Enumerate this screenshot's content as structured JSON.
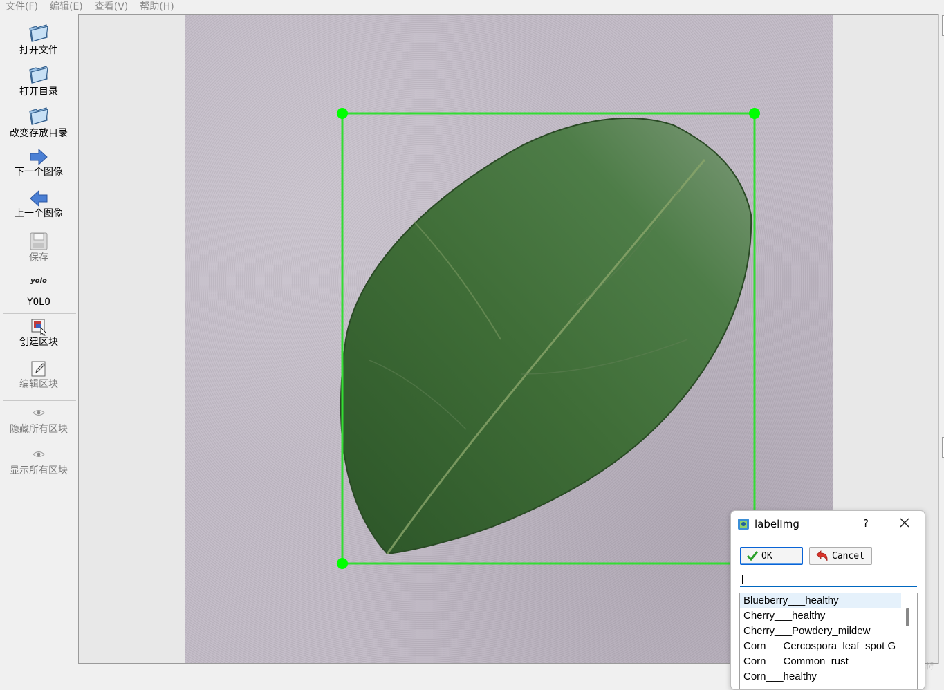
{
  "menubar": {
    "items": [
      "文件(F)",
      "编辑(E)",
      "查看(V)",
      "帮助(H)"
    ]
  },
  "toolbar": {
    "open_file": "打开文件",
    "open_dir": "打开目录",
    "change_save_dir": "改变存放目录",
    "next_image": "下一个图像",
    "prev_image": "上一个图像",
    "save": "保存",
    "yolo_icon_text": "yolo",
    "yolo_label": "YOLO",
    "create_box": "创建区块",
    "edit_box": "编辑区块",
    "hide_all": "隐藏所有区块",
    "show_all": "显示所有区块"
  },
  "colors": {
    "bbox": "#33dd33",
    "bbox_vertex": "#00ff00",
    "leaf": "#3d6b35",
    "background_paper": "#bcb5c0",
    "input_focus": "#0067c0",
    "list_selected": "#e5f1fb"
  },
  "dialog": {
    "title": "labelImg",
    "help": "?",
    "ok_label": "OK",
    "cancel_label": "Cancel",
    "input_value": "",
    "labels": [
      "Blueberry___healthy",
      "Cherry___healthy",
      "Cherry___Powdery_mildew",
      "Corn___Cercospora_leaf_spot G",
      "Corn___Common_rust",
      "Corn___healthy"
    ],
    "selected_index": 0
  },
  "watermark": "CSDN @苏衍"
}
